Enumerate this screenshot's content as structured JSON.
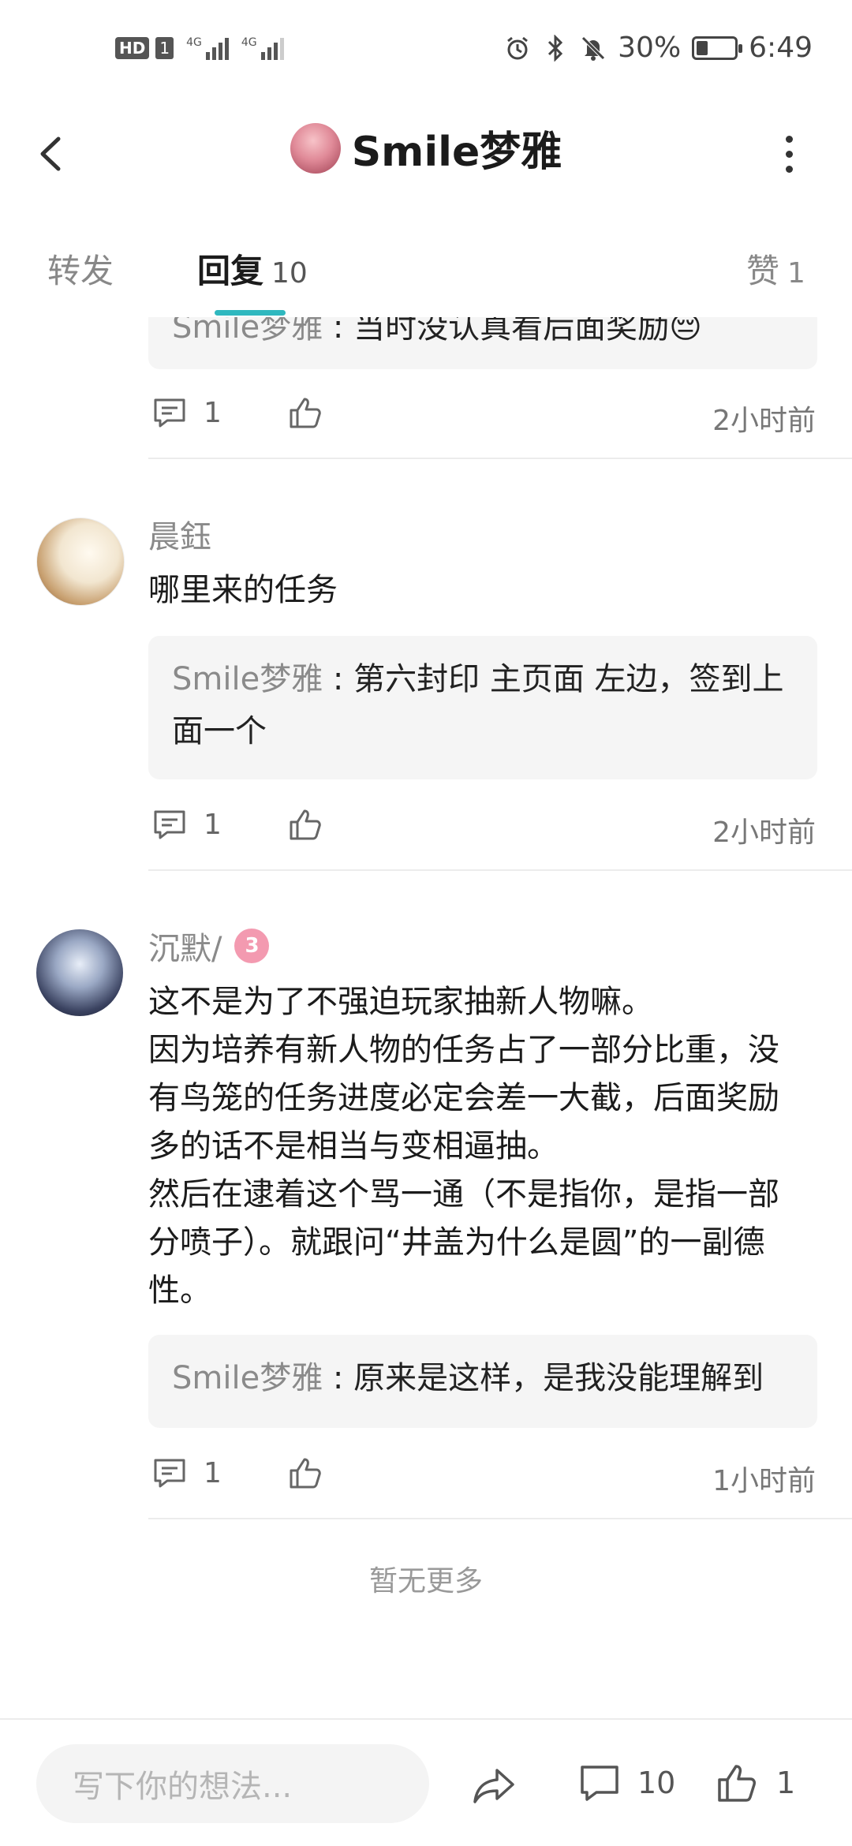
{
  "status_bar": {
    "hd": "HD",
    "sim": "1",
    "net1": "4G",
    "net2": "4G",
    "battery_text": "30%",
    "battery_level": 0.3,
    "time": "6:49"
  },
  "header": {
    "title": "Smile梦雅"
  },
  "tabs": [
    {
      "label": "转发"
    },
    {
      "label": "回复",
      "count": "10"
    },
    {
      "label": "赞",
      "count": "1"
    }
  ],
  "comments": [
    {
      "quote_name": "Smile梦雅",
      "quote_sep": " : ",
      "quote_text": "当时没认真看后面奖励😔",
      "reply_count": "1",
      "time": "2小时前"
    },
    {
      "name": "晨鈺",
      "text": "哪里来的任务",
      "quote_name": "Smile梦雅",
      "quote_sep": " : ",
      "quote_text": "第六封印  主页面 左边，签到上面一个",
      "reply_count": "1",
      "time": "2小时前"
    },
    {
      "name": "沉默/",
      "badge": "3",
      "text_lines": [
        "这不是为了不强迫玩家抽新人物嘛。",
        "因为培养有新人物的任务占了一部分比重，没",
        "有鸟笼的任务进度必定会差一大截，后面奖励",
        "多的话不是相当与变相逼抽。",
        "然后在逮着这个骂一通（不是指你，是指一部",
        "分喷子）。就跟问“井盖为什么是圆”的一副德",
        "性。"
      ],
      "quote_name": "Smile梦雅",
      "quote_sep": " : ",
      "quote_text": "原来是这样，是我没能理解到",
      "reply_count": "1",
      "time": "1小时前"
    }
  ],
  "no_more": "暂无更多",
  "bottom_bar": {
    "input_placeholder": "写下你的想法...",
    "comment_count": "10",
    "like_count": "1"
  }
}
